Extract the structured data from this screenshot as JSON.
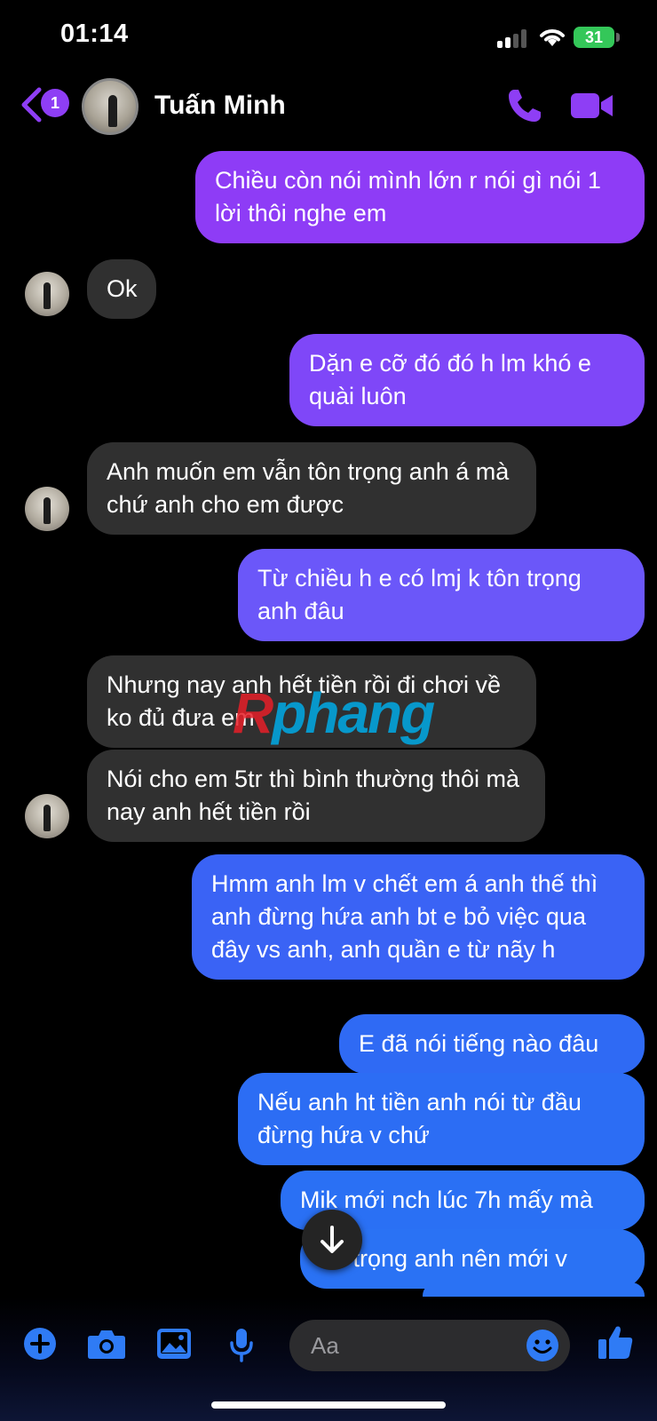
{
  "status_bar": {
    "time": "01:14",
    "battery": "31"
  },
  "header": {
    "back_badge": "1",
    "contact_name": "Tuấn Minh"
  },
  "messages": [
    {
      "text": "Chiều còn nói mình lớn r nói gì nói 1 lời thôi nghe em"
    },
    {
      "text": "Ok"
    },
    {
      "text": "Dặn e cỡ đó đó h lm khó e quài luôn"
    },
    {
      "text": "Anh muốn em vẫn tôn trọng anh á mà chứ anh cho em được"
    },
    {
      "text": "Từ chiều h e có lmj k tôn trọng anh đâu"
    },
    {
      "text": "Nhưng nay anh hết tiền rồi đi chơi về ko đủ đưa em"
    },
    {
      "text": "Nói cho em 5tr thì bình thường thôi mà nay anh hết tiền rồi"
    },
    {
      "text": "Hmm anh lm v chết em á anh thế thì anh đừng hứa anh bt e bỏ việc qua đây vs anh, anh quần e từ nãy h"
    },
    {
      "text": "E đã nói tiếng nào đâu"
    },
    {
      "text": "Nếu anh ht tiền anh nói từ đầu đừng hứa v chứ"
    },
    {
      "text": "Mik mới nch lúc 7h mấy mà"
    },
    {
      "text": "ôn trọng anh nên mới v"
    }
  ],
  "watermark": {
    "letter": "R",
    "rest": "phang"
  },
  "composer": {
    "placeholder": "Aa"
  },
  "colors": {
    "accent_purple": "#8e3cf6",
    "accent_blue": "#2a72f4",
    "incoming_bubble": "#303030",
    "battery_green": "#34c759"
  },
  "icons": [
    "back-chevron-icon",
    "call-icon",
    "video-call-icon",
    "plus-icon",
    "camera-icon",
    "gallery-icon",
    "microphone-icon",
    "emoji-icon",
    "thumbs-up-icon",
    "arrow-down-icon"
  ]
}
